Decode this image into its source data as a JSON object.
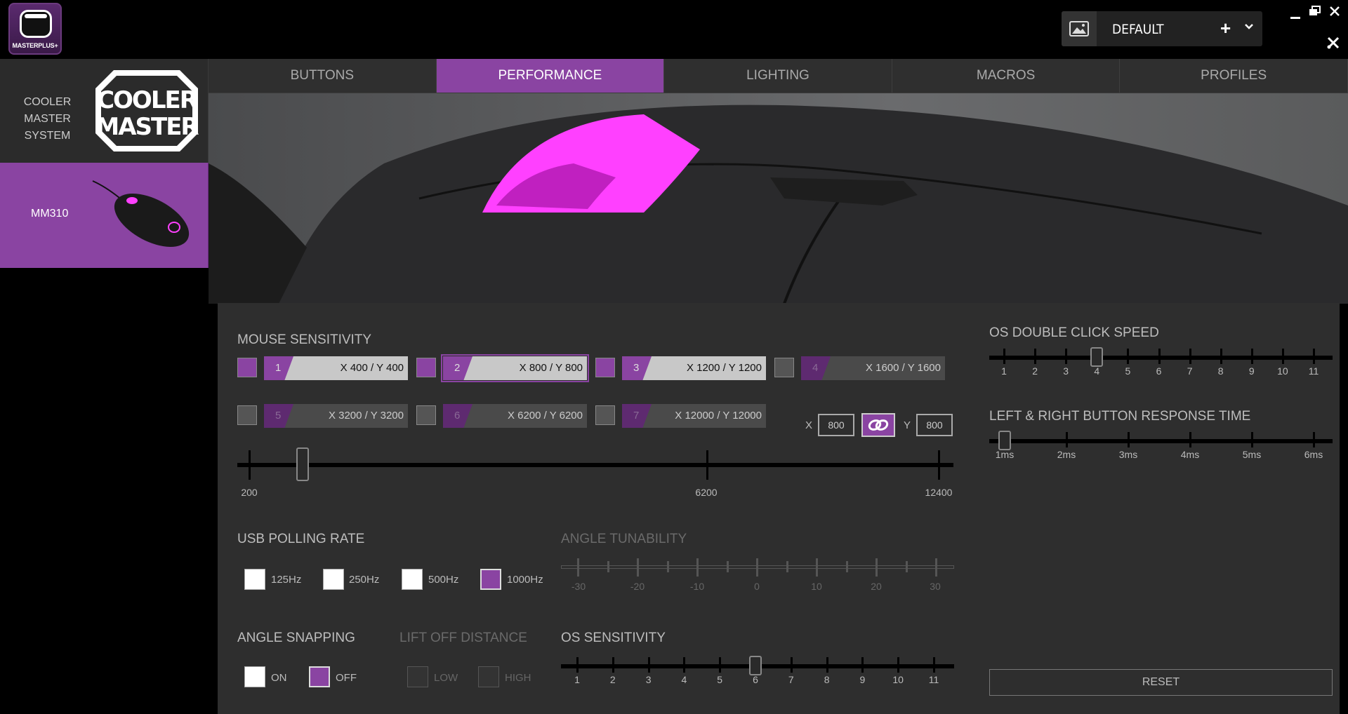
{
  "app": {
    "logo_text": "MASTERPLUS+"
  },
  "profile": {
    "name": "DEFAULT",
    "add_symbol": "+",
    "chevron": "⌄"
  },
  "window": {
    "minimize": "–",
    "restore": "❐",
    "close": "✕",
    "tools": "✂"
  },
  "sidebar": {
    "system_label": "COOLER MASTER SYSTEM",
    "device_label": "MM310"
  },
  "tabs": [
    {
      "label": "BUTTONS",
      "active": false
    },
    {
      "label": "PERFORMANCE",
      "active": true
    },
    {
      "label": "LIGHTING",
      "active": false
    },
    {
      "label": "MACROS",
      "active": false
    },
    {
      "label": "PROFILES",
      "active": false
    }
  ],
  "sensitivity": {
    "title": "MOUSE SENSITIVITY",
    "slots": [
      {
        "num": "1",
        "value": "X 400 / Y 400",
        "enabled": true
      },
      {
        "num": "2",
        "value": "X 800 / Y 800",
        "enabled": true,
        "selected": true
      },
      {
        "num": "3",
        "value": "X 1200 / Y 1200",
        "enabled": true
      },
      {
        "num": "4",
        "value": "X 1600 / Y 1600",
        "enabled": false
      },
      {
        "num": "5",
        "value": "X 3200 / Y 3200",
        "enabled": false
      },
      {
        "num": "6",
        "value": "X 6200 / Y 6200",
        "enabled": false
      },
      {
        "num": "7",
        "value": "X 12000 / Y 12000",
        "enabled": false
      }
    ],
    "x_label": "X",
    "x_value": "800",
    "y_label": "Y",
    "y_value": "800",
    "slider": {
      "min_label": "200",
      "mid_label": "6200",
      "max_label": "12400",
      "value": 800
    }
  },
  "polling": {
    "title": "USB POLLING RATE",
    "options": [
      {
        "label": "125Hz",
        "checked": false
      },
      {
        "label": "250Hz",
        "checked": false
      },
      {
        "label": "500Hz",
        "checked": false
      },
      {
        "label": "1000Hz",
        "checked": true
      }
    ]
  },
  "angle_tunability": {
    "title": "ANGLE TUNABILITY",
    "labels": [
      "-30",
      "-20",
      "-10",
      "0",
      "10",
      "20",
      "30"
    ]
  },
  "angle_snapping": {
    "title": "ANGLE SNAPPING",
    "on_label": "ON",
    "off_label": "OFF",
    "value": "OFF"
  },
  "lift_off": {
    "title": "LIFT OFF DISTANCE",
    "low_label": "LOW",
    "high_label": "HIGH"
  },
  "os_sensitivity": {
    "title": "OS SENSITIVITY",
    "labels": [
      "1",
      "2",
      "3",
      "4",
      "5",
      "6",
      "7",
      "8",
      "9",
      "10",
      "11"
    ],
    "value": 6
  },
  "double_click": {
    "title": "OS DOUBLE CLICK SPEED",
    "labels": [
      "1",
      "2",
      "3",
      "4",
      "5",
      "6",
      "7",
      "8",
      "9",
      "10",
      "11"
    ],
    "value": 4
  },
  "response_time": {
    "title": "LEFT & RIGHT BUTTON RESPONSE TIME",
    "labels": [
      "1ms",
      "2ms",
      "3ms",
      "4ms",
      "5ms",
      "6ms"
    ],
    "value": "1ms"
  },
  "reset_label": "RESET",
  "colors": {
    "accent": "#8a44a2",
    "glow": "#ff40ff"
  },
  "icons": [
    "image-icon",
    "plus-icon",
    "chevron-down-icon",
    "minimize-icon",
    "restore-icon",
    "close-icon",
    "tools-icon",
    "link-icon"
  ]
}
